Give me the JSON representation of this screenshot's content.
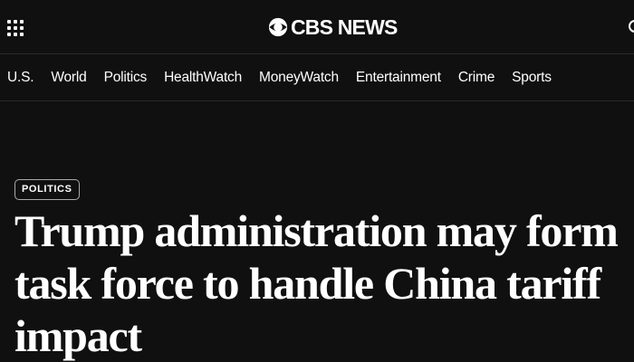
{
  "header": {
    "brand": "CBS NEWS",
    "menu_icon": "grid-menu-icon",
    "logo_icon": "cbs-eye-icon"
  },
  "nav": {
    "items": [
      "U.S.",
      "World",
      "Politics",
      "HealthWatch",
      "MoneyWatch",
      "Entertainment",
      "Crime",
      "Sports"
    ]
  },
  "article": {
    "category": "POLITICS",
    "headline": "Trump administration may form task force to handle China tariff impact"
  },
  "colors": {
    "background": "#101010",
    "text": "#ffffff",
    "divider": "#2a2a2a",
    "badge_border": "#a9a9a9"
  }
}
